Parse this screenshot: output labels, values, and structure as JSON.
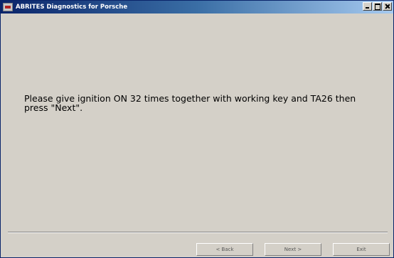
{
  "window": {
    "title": "ABRITES Diagnostics for Porsche"
  },
  "main": {
    "message": "Please give ignition ON 32 times together with working key and TA26 then press \"Next\"."
  },
  "footer": {
    "back_label": "< Back",
    "next_label": "Next >",
    "exit_label": "Exit"
  },
  "colors": {
    "background": "#d4d0c8",
    "titlebar_start": "#0a246a",
    "titlebar_end": "#a6caf0"
  },
  "icons": {
    "app": "app-icon",
    "minimize": "minimize-icon",
    "maximize": "maximize-icon",
    "close": "close-icon"
  }
}
